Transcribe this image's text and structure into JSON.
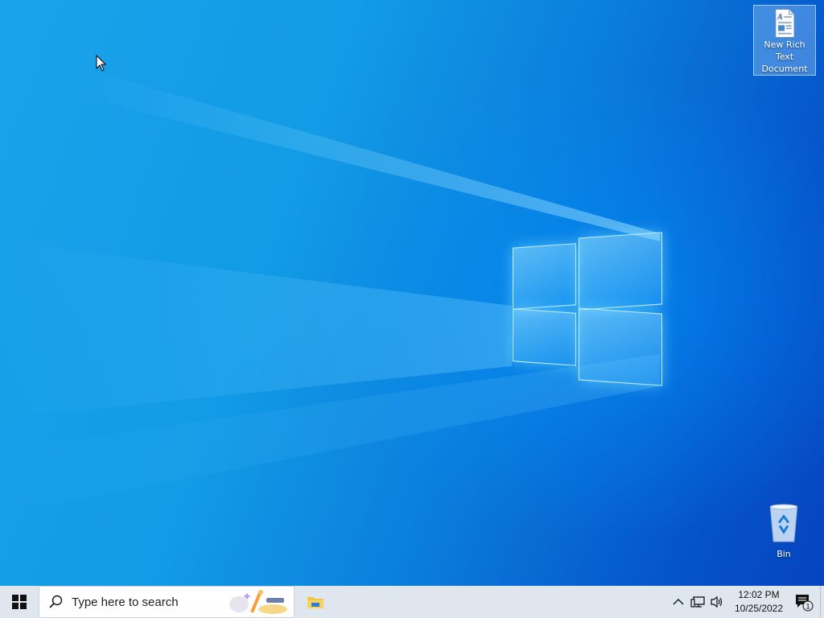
{
  "desktop": {
    "icons": [
      {
        "label": "New Rich Text Document",
        "icon": "rich-text-document-icon",
        "selected": true
      },
      {
        "label": "Bin",
        "icon": "recycle-bin-icon",
        "selected": false
      }
    ]
  },
  "taskbar": {
    "start_icon": "windows-logo-icon",
    "search": {
      "placeholder": "Type here to search",
      "icon": "search-icon"
    },
    "pinned": [
      {
        "icon": "file-explorer-icon"
      }
    ],
    "tray": {
      "icons": [
        "chevron-up-icon",
        "network-icon",
        "volume-icon"
      ],
      "time": "12:02 PM",
      "date": "10/25/2022",
      "notification_count": "1"
    }
  },
  "colors": {
    "taskbar_bg": "#dfe6ee",
    "wallpaper_primary": "#129be6",
    "wallpaper_dark": "#0644bf"
  }
}
